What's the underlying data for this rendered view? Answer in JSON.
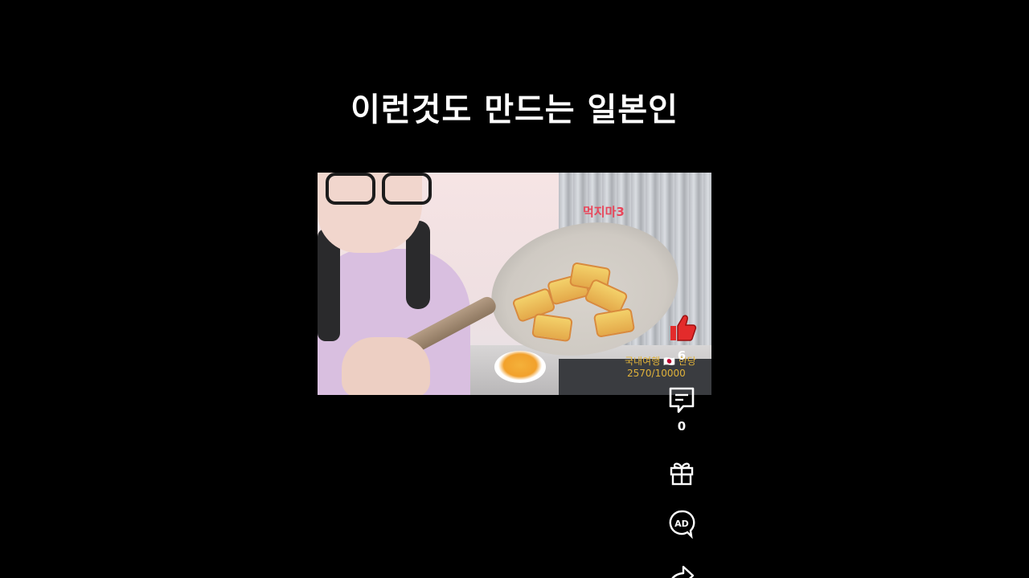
{
  "video": {
    "title": "이런것도 만드는 일본인",
    "overlay_name": "먹지마3",
    "overlay_rank": "국내여행 🇯🇵 한당",
    "overlay_score": "2570/10000"
  },
  "actions": {
    "like_count": "6",
    "comment_count": "0"
  },
  "colors": {
    "background": "#000000",
    "like_red": "#e32b2b",
    "text": "#ffffff"
  },
  "icons": [
    "thumb-up-icon",
    "comment-icon",
    "gift-icon",
    "ad-icon",
    "share-icon"
  ]
}
